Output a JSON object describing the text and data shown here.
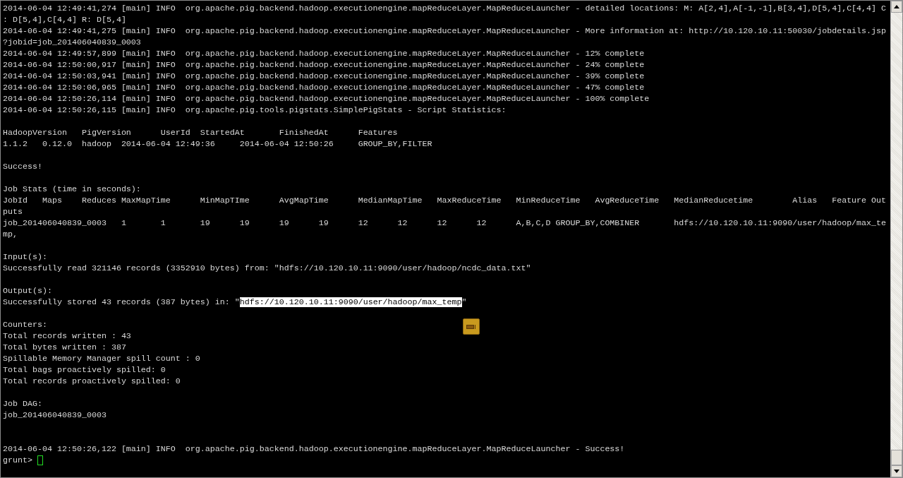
{
  "lines": [
    {
      "kind": "text",
      "text": "2014-06-04 12:49:41,274 [main] INFO  org.apache.pig.backend.hadoop.executionengine.mapReduceLayer.MapReduceLauncher - detailed locations: M: A[2,4],A[-1,-1],B[3,4],D[5,4],C[4,4] C"
    },
    {
      "kind": "text",
      "text": ": D[5,4],C[4,4] R: D[5,4]"
    },
    {
      "kind": "text",
      "text": "2014-06-04 12:49:41,275 [main] INFO  org.apache.pig.backend.hadoop.executionengine.mapReduceLayer.MapReduceLauncher - More information at: http://10.120.10.11:50030/jobdetails.jsp"
    },
    {
      "kind": "text",
      "text": "?jobid=job_201406040839_0003"
    },
    {
      "kind": "text",
      "text": "2014-06-04 12:49:57,899 [main] INFO  org.apache.pig.backend.hadoop.executionengine.mapReduceLayer.MapReduceLauncher - 12% complete"
    },
    {
      "kind": "text",
      "text": "2014-06-04 12:50:00,917 [main] INFO  org.apache.pig.backend.hadoop.executionengine.mapReduceLayer.MapReduceLauncher - 24% complete"
    },
    {
      "kind": "text",
      "text": "2014-06-04 12:50:03,941 [main] INFO  org.apache.pig.backend.hadoop.executionengine.mapReduceLayer.MapReduceLauncher - 39% complete"
    },
    {
      "kind": "text",
      "text": "2014-06-04 12:50:06,965 [main] INFO  org.apache.pig.backend.hadoop.executionengine.mapReduceLayer.MapReduceLauncher - 47% complete"
    },
    {
      "kind": "text",
      "text": "2014-06-04 12:50:26,114 [main] INFO  org.apache.pig.backend.hadoop.executionengine.mapReduceLayer.MapReduceLauncher - 100% complete"
    },
    {
      "kind": "text",
      "text": "2014-06-04 12:50:26,115 [main] INFO  org.apache.pig.tools.pigstats.SimplePigStats - Script Statistics:"
    },
    {
      "kind": "blank"
    },
    {
      "kind": "text",
      "text": "HadoopVersion   PigVersion      UserId  StartedAt       FinishedAt      Features"
    },
    {
      "kind": "text",
      "text": "1.1.2   0.12.0  hadoop  2014-06-04 12:49:36     2014-06-04 12:50:26     GROUP_BY,FILTER"
    },
    {
      "kind": "blank"
    },
    {
      "kind": "text",
      "text": "Success!"
    },
    {
      "kind": "blank"
    },
    {
      "kind": "text",
      "text": "Job Stats (time in seconds):"
    },
    {
      "kind": "text",
      "text": "JobId   Maps    Reduces MaxMapTime      MinMapTIme      AvgMapTime      MedianMapTime   MaxReduceTime   MinReduceTime   AvgReduceTime   MedianReducetime        Alias   Feature Out"
    },
    {
      "kind": "text",
      "text": "puts"
    },
    {
      "kind": "text",
      "text": "job_201406040839_0003   1       1       19      19      19      19      12      12      12      12      A,B,C,D GROUP_BY,COMBINER       hdfs://10.120.10.11:9090/user/hadoop/max_te"
    },
    {
      "kind": "text",
      "text": "mp,"
    },
    {
      "kind": "blank"
    },
    {
      "kind": "text",
      "text": "Input(s):"
    },
    {
      "kind": "text",
      "text": "Successfully read 321146 records (3352910 bytes) from: \"hdfs://10.120.10.11:9090/user/hadoop/ncdc_data.txt\""
    },
    {
      "kind": "blank"
    },
    {
      "kind": "text",
      "text": "Output(s):"
    },
    {
      "kind": "segmented",
      "segments": [
        {
          "text": "Successfully stored 43 records (387 bytes) in: \"",
          "selected": false
        },
        {
          "text": "hdfs://10.120.10.11:9090/user/hadoop/max_temp",
          "selected": true
        },
        {
          "text": "\"",
          "selected": false
        }
      ]
    },
    {
      "kind": "blank"
    },
    {
      "kind": "text",
      "text": "Counters:"
    },
    {
      "kind": "text",
      "text": "Total records written : 43"
    },
    {
      "kind": "text",
      "text": "Total bytes written : 387"
    },
    {
      "kind": "text",
      "text": "Spillable Memory Manager spill count : 0"
    },
    {
      "kind": "text",
      "text": "Total bags proactively spilled: 0"
    },
    {
      "kind": "text",
      "text": "Total records proactively spilled: 0"
    },
    {
      "kind": "blank"
    },
    {
      "kind": "text",
      "text": "Job DAG:"
    },
    {
      "kind": "text",
      "text": "job_201406040839_0003"
    },
    {
      "kind": "blank"
    },
    {
      "kind": "blank"
    },
    {
      "kind": "text",
      "text": "2014-06-04 12:50:26,122 [main] INFO  org.apache.pig.backend.hadoop.executionengine.mapReduceLayer.MapReduceLauncher - Success!"
    }
  ],
  "prompt": {
    "text": "grunt>"
  }
}
